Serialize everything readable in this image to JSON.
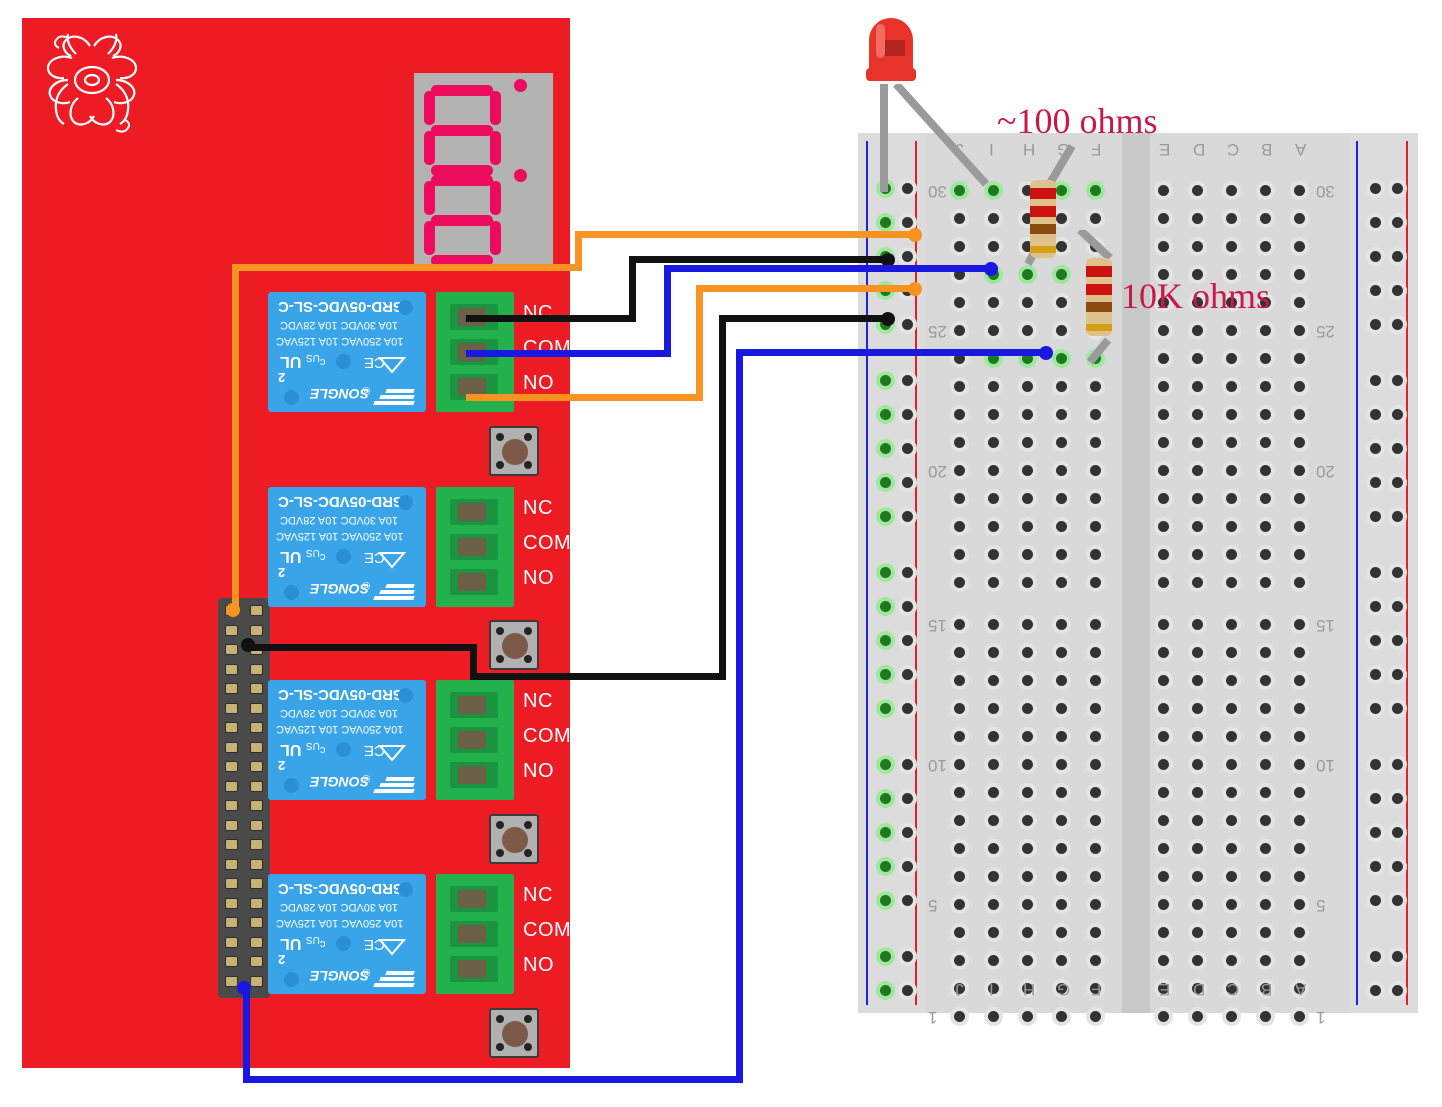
{
  "diagram": {
    "title": "Raspberry Pi relay board wired to breadboard with LED and resistors",
    "background": "#ffffff"
  },
  "board": {
    "name": "raspberry-pi-relay-hat",
    "color": "#ed1c24",
    "logo": "raspberry-pi-logo"
  },
  "display": {
    "name": "seven-segment-display",
    "digits": [
      "8",
      "8"
    ],
    "segment_color": "#ec0b5d",
    "body_color": "#b3b3b3",
    "decimal_points": 2
  },
  "gpio": {
    "name": "gpio-header",
    "columns": 2,
    "rows": 20,
    "pin_color": "#c8b273",
    "body_color": "#4a4a4a"
  },
  "relays": [
    {
      "part": "SRD-05VDC-SL-C",
      "rating_line1": "10A 250VAC   10A 125VAC",
      "rating_line2": "10A 30VDC   10A 28VDC",
      "brand": "SONGLE",
      "cert_ul": "UL",
      "cert_us": "US",
      "cert_c": "c",
      "cert_2": "2",
      "cert_ce": "CE",
      "terminals": [
        "NC",
        "COM",
        "NO"
      ],
      "body_color": "#39a5e8",
      "terminal_block_color": "#22b14c"
    },
    {
      "part": "SRD-05VDC-SL-C",
      "rating_line1": "10A 250VAC   10A 125VAC",
      "rating_line2": "10A 30VDC   10A 28VDC",
      "brand": "SONGLE",
      "cert_ul": "UL",
      "cert_us": "US",
      "cert_c": "c",
      "cert_2": "2",
      "cert_ce": "CE",
      "terminals": [
        "NC",
        "COM",
        "NO"
      ],
      "body_color": "#39a5e8",
      "terminal_block_color": "#22b14c"
    },
    {
      "part": "SRD-05VDC-SL-C",
      "rating_line1": "10A 250VAC   10A 125VAC",
      "rating_line2": "10A 30VDC   10A 28VDC",
      "brand": "SONGLE",
      "cert_ul": "UL",
      "cert_us": "US",
      "cert_c": "c",
      "cert_2": "2",
      "cert_ce": "CE",
      "terminals": [
        "NC",
        "COM",
        "NO"
      ],
      "body_color": "#39a5e8",
      "terminal_block_color": "#22b14c"
    },
    {
      "part": "SRD-05VDC-SL-C",
      "rating_line1": "10A 250VAC   10A 125VAC",
      "rating_line2": "10A 30VDC   10A 28VDC",
      "brand": "SONGLE",
      "cert_ul": "UL",
      "cert_us": "US",
      "cert_c": "c",
      "cert_2": "2",
      "cert_ce": "CE",
      "terminals": [
        "NC",
        "COM",
        "NO"
      ],
      "body_color": "#39a5e8",
      "terminal_block_color": "#22b14c"
    }
  ],
  "buttons": [
    {
      "name": "push-button-1"
    },
    {
      "name": "push-button-2"
    },
    {
      "name": "push-button-3"
    },
    {
      "name": "push-button-4"
    }
  ],
  "breadboard": {
    "name": "solderless-breadboard",
    "orientation": "rotated-180",
    "column_labels_left": [
      "J",
      "I",
      "H",
      "G",
      "F"
    ],
    "column_labels_right": [
      "E",
      "D",
      "C",
      "B",
      "A"
    ],
    "row_labels": [
      "30",
      "25",
      "20",
      "15",
      "10",
      "5",
      "1"
    ],
    "rail_positive_color": "#dd2222",
    "rail_negative_color": "#2222dd",
    "body_color": "#d9d9d9"
  },
  "components": {
    "led": {
      "name": "red-led",
      "color": "#e8332a",
      "leg_color": "#9a9a9a"
    },
    "resistors": [
      {
        "name": "resistor-100-ohm",
        "label": "~100 ohms",
        "bands": [
          "#cc1111",
          "#cc1111",
          "#8a4b10",
          "#d4a017"
        ],
        "body": "#dfc18c"
      },
      {
        "name": "resistor-10k-ohm",
        "label": "10K ohms",
        "bands": [
          "#cc1111",
          "#cc1111",
          "#8a4b10",
          "#d4a017"
        ],
        "body": "#dfc18c"
      }
    ]
  },
  "labels": {
    "resistor_100": "~100 ohms",
    "resistor_10k": "10K ohms",
    "label_color": "#c9184a"
  },
  "wires": {
    "orange": "#f79321",
    "black": "#111111",
    "blue": "#1818e0",
    "gray": "#9a9a9a"
  }
}
